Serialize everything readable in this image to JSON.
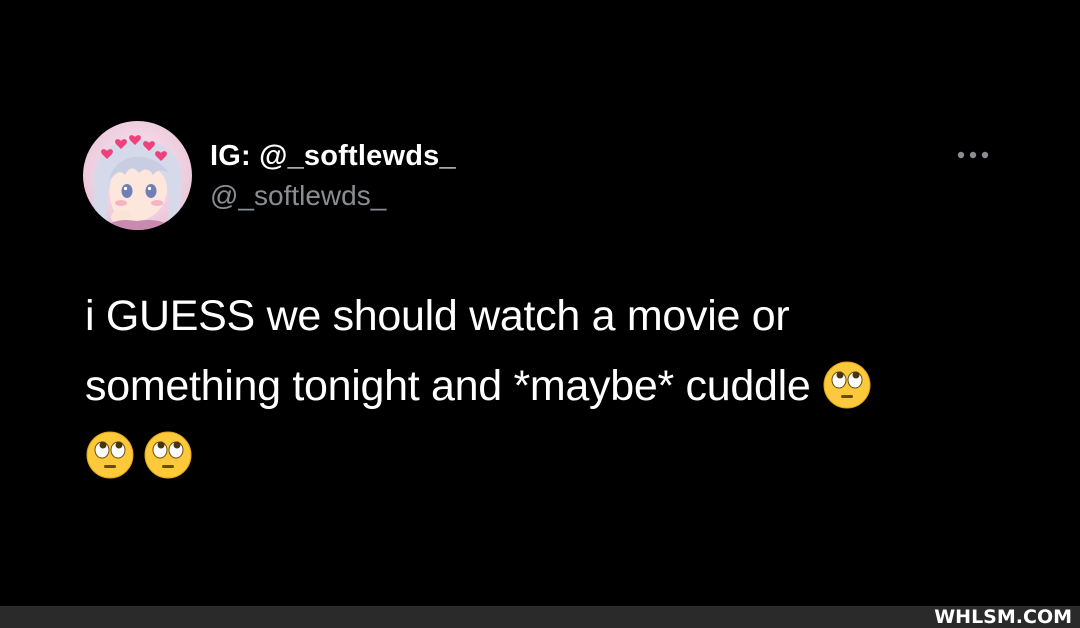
{
  "tweet": {
    "display_name": "IG: @_softlewds_",
    "handle": "@_softlewds_",
    "text_line1": "i GUESS we should watch a movie or",
    "text_line2": "something tonight and *maybe* cuddle",
    "emoji": "face-with-rolling-eyes",
    "more_icon": "more-horizontal-icon",
    "avatar": "anime-avatar-with-hearts"
  },
  "watermark": {
    "text": "WHLSM.COM"
  },
  "colors": {
    "background": "#000000",
    "text": "#ffffff",
    "handle": "#8a8d91",
    "footer_bar": "#2a2a2a"
  }
}
